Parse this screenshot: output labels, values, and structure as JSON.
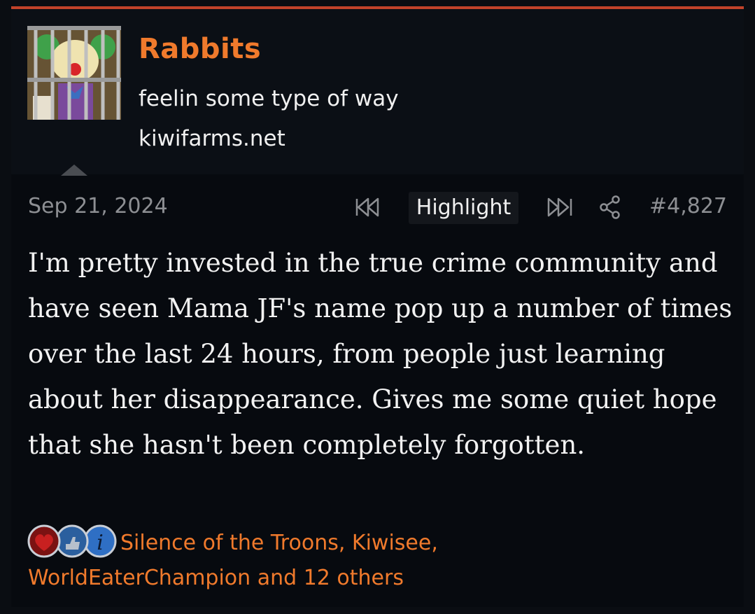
{
  "user": {
    "name": "Rabbits",
    "title": "feelin some type of way",
    "site": "kiwifarms.net",
    "avatar_icon": "jailed-clown-avatar"
  },
  "post": {
    "date": "Sep 21, 2024",
    "highlight_label": "Highlight",
    "number": "#4,827",
    "message": "I'm pretty invested in the true crime community and have seen Mama JF's name pop up a number of times over the last 24 hours, from people just learning about her disappearance. Gives me some quiet hope that she hasn't been completely forgotten."
  },
  "reactions": {
    "icons": [
      "heart-reaction-icon",
      "thumbs-up-reaction-icon",
      "informative-reaction-icon"
    ],
    "summary": "Silence of the Troons, Kiwisee, WorldEaterChampion and 12 others"
  },
  "colors": {
    "accent": "#f07a2c",
    "top_border": "#c2432a",
    "background": "#070a0f"
  }
}
